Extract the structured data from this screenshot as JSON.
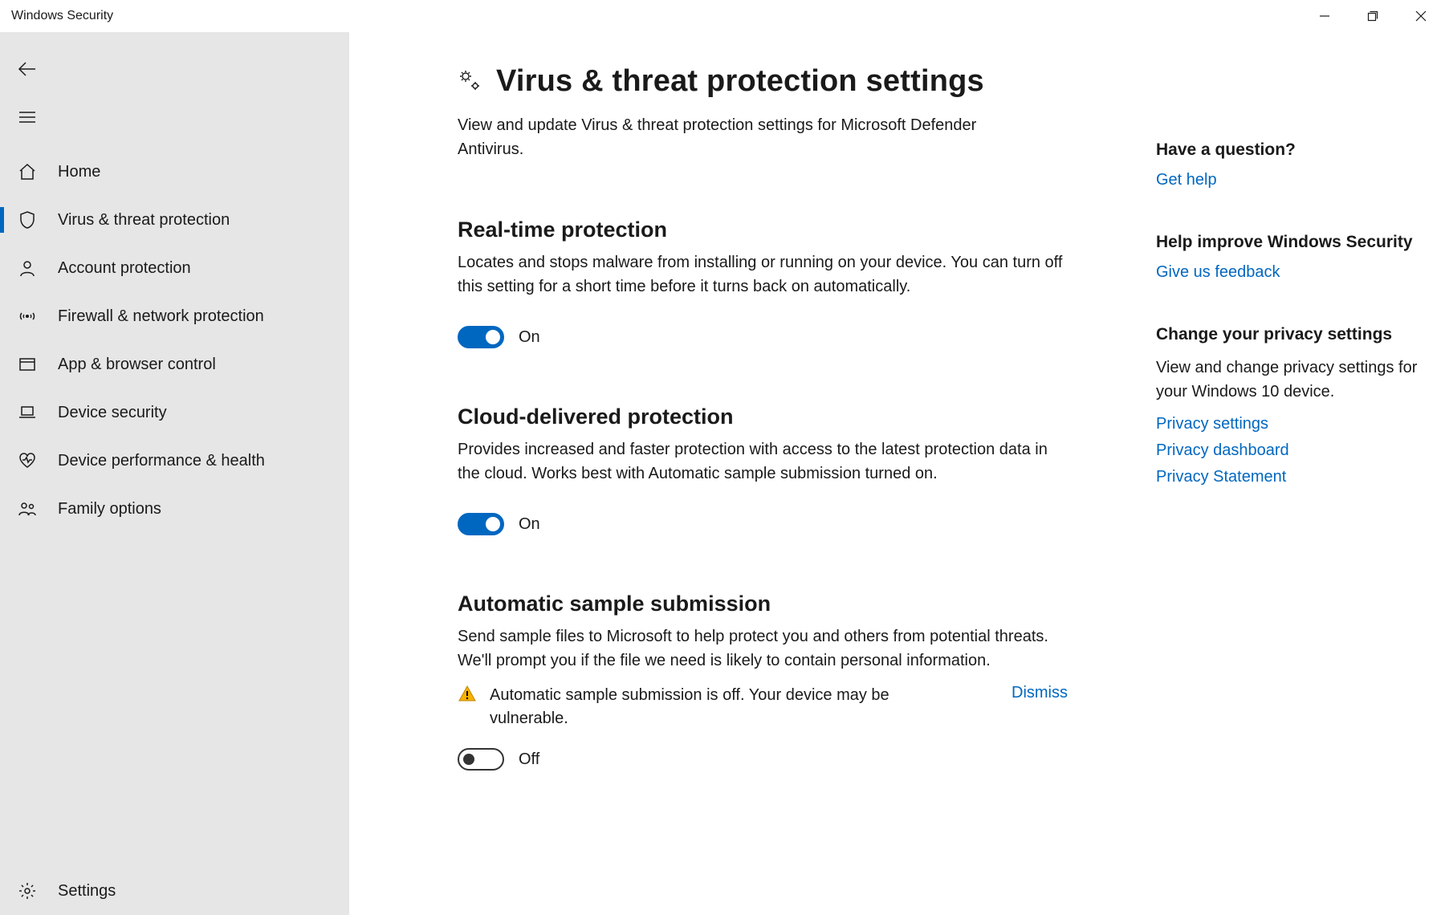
{
  "window": {
    "title": "Windows Security"
  },
  "sidebar": {
    "items": [
      {
        "id": "home",
        "label": "Home",
        "active": false
      },
      {
        "id": "virus",
        "label": "Virus & threat protection",
        "active": true
      },
      {
        "id": "account",
        "label": "Account protection",
        "active": false
      },
      {
        "id": "firewall",
        "label": "Firewall & network protection",
        "active": false
      },
      {
        "id": "appbrowser",
        "label": "App & browser control",
        "active": false
      },
      {
        "id": "device",
        "label": "Device security",
        "active": false
      },
      {
        "id": "performance",
        "label": "Device performance & health",
        "active": false
      },
      {
        "id": "family",
        "label": "Family options",
        "active": false
      }
    ],
    "settings_label": "Settings"
  },
  "page": {
    "title": "Virus & threat protection settings",
    "subtitle": "View and update Virus & threat protection settings for Microsoft Defender Antivirus."
  },
  "sections": {
    "realtime": {
      "title": "Real-time protection",
      "desc": "Locates and stops malware from installing or running on your device. You can turn off this setting for a short time before it turns back on automatically.",
      "state_label": "On",
      "on": true
    },
    "cloud": {
      "title": "Cloud-delivered protection",
      "desc": "Provides increased and faster protection with access to the latest protection data in the cloud. Works best with Automatic sample submission turned on.",
      "state_label": "On",
      "on": true
    },
    "sample": {
      "title": "Automatic sample submission",
      "desc": "Send sample files to Microsoft to help protect you and others from potential threats. We'll prompt you if the file we need is likely to contain personal information.",
      "warning": "Automatic sample submission is off. Your device may be vulnerable.",
      "dismiss_label": "Dismiss",
      "state_label": "Off",
      "on": false
    }
  },
  "aside": {
    "question": {
      "title": "Have a question?",
      "link": "Get help"
    },
    "improve": {
      "title": "Help improve Windows Security",
      "link": "Give us feedback"
    },
    "privacy": {
      "title": "Change your privacy settings",
      "desc": "View and change privacy settings for your Windows 10 device.",
      "links": [
        "Privacy settings",
        "Privacy dashboard",
        "Privacy Statement"
      ]
    }
  }
}
